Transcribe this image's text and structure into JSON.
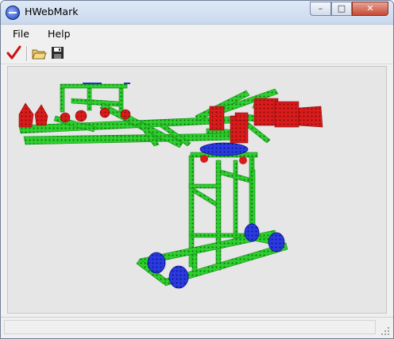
{
  "window": {
    "title": "HWebMark",
    "icon": "app-globe-icon"
  },
  "window_controls": {
    "minimize": "–",
    "maximize": "□",
    "close": "✕"
  },
  "menu": {
    "items": [
      {
        "label": "File"
      },
      {
        "label": "Help"
      }
    ]
  },
  "toolbar": {
    "buttons": [
      {
        "icon": "checkmark-icon"
      },
      {
        "icon": "open-folder-icon"
      },
      {
        "icon": "save-disk-icon"
      }
    ]
  },
  "scene": {
    "description_icon": "crane-model-3d",
    "colors": {
      "girders": "#27c427",
      "girder_edge": "#138a13",
      "red_parts": "#d81b1b",
      "wheels": "#1f2fd6",
      "background": "#e6e6e6"
    }
  },
  "status": {
    "text": ""
  }
}
